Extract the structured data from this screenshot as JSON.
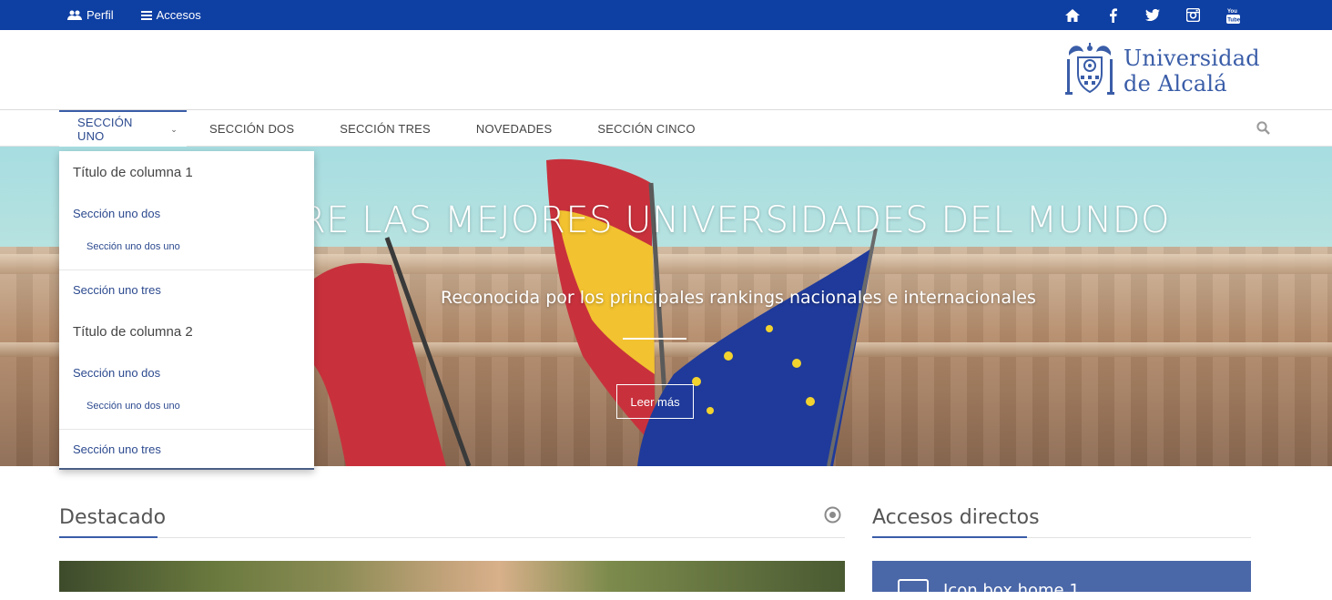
{
  "topbar": {
    "profile_label": "Perfil",
    "access_label": "Accesos",
    "social_icons": [
      "home-icon",
      "facebook-icon",
      "twitter-icon",
      "instagram-icon",
      "youtube-icon"
    ],
    "youtube_text": "You Tube"
  },
  "logo": {
    "line1": "Universidad",
    "line2": "de Alcalá"
  },
  "nav": {
    "items": [
      {
        "label": "SECCIÓN UNO"
      },
      {
        "label": "SECCIÓN DOS"
      },
      {
        "label": "SECCIÓN TRES"
      },
      {
        "label": "NOVEDADES"
      },
      {
        "label": "SECCIÓN CINCO"
      }
    ]
  },
  "dropdown": {
    "col1_title": "Título de columna 1",
    "col1_link1": "Sección uno dos",
    "col1_sublink1": "Sección uno dos uno",
    "col1_link2": "Sección uno tres",
    "col2_title": "Título de columna 2",
    "col2_link1": "Sección uno dos",
    "col2_sublink1": "Sección uno dos uno",
    "col2_link2": "Sección uno tres"
  },
  "hero": {
    "title": "RE LAS MEJORES UNIVERSIDADES DEL MUNDO",
    "subtitle": "Reconocida por los principales rankings nacionales e internacionales",
    "button_label": "Leer más"
  },
  "featured": {
    "title": "Destacado"
  },
  "quick_access": {
    "title": "Accesos directos",
    "box_label": "Icon box home 1"
  },
  "colors": {
    "topbar": "#0e3fa3",
    "accent": "#3a5da8",
    "quick_box": "#4a67a8"
  }
}
